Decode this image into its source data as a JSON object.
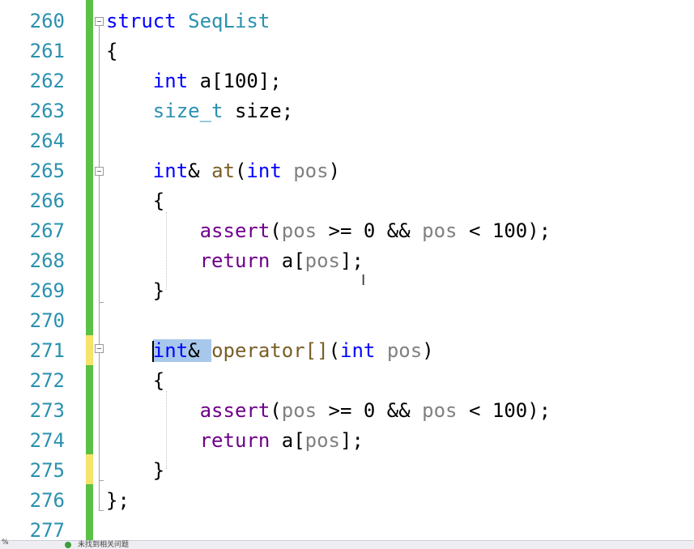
{
  "editor": {
    "line_numbers": [
      "260",
      "261",
      "262",
      "263",
      "264",
      "265",
      "266",
      "267",
      "268",
      "269",
      "270",
      "271",
      "272",
      "273",
      "274",
      "275",
      "276",
      "277"
    ],
    "lines": [
      [
        {
          "t": "struct ",
          "c": "kw"
        },
        {
          "t": "SeqList",
          "c": "ty"
        }
      ],
      [
        {
          "t": "{",
          "c": ""
        }
      ],
      [
        {
          "t": "    ",
          "c": ""
        },
        {
          "t": "int",
          "c": "kw"
        },
        {
          "t": " a[100];",
          "c": ""
        }
      ],
      [
        {
          "t": "    ",
          "c": ""
        },
        {
          "t": "size_t",
          "c": "ty"
        },
        {
          "t": " size;",
          "c": ""
        }
      ],
      [],
      [
        {
          "t": "    ",
          "c": ""
        },
        {
          "t": "int",
          "c": "kw"
        },
        {
          "t": "& ",
          "c": ""
        },
        {
          "t": "at",
          "c": "fn"
        },
        {
          "t": "(",
          "c": ""
        },
        {
          "t": "int",
          "c": "kw"
        },
        {
          "t": " ",
          "c": ""
        },
        {
          "t": "pos",
          "c": "par"
        },
        {
          "t": ")",
          "c": ""
        }
      ],
      [
        {
          "t": "    {",
          "c": ""
        }
      ],
      [
        {
          "t": "        ",
          "c": ""
        },
        {
          "t": "assert",
          "c": "mac"
        },
        {
          "t": "(",
          "c": ""
        },
        {
          "t": "pos",
          "c": "par"
        },
        {
          "t": " >= 0 && ",
          "c": ""
        },
        {
          "t": "pos",
          "c": "par"
        },
        {
          "t": " < 100);",
          "c": ""
        }
      ],
      [
        {
          "t": "        ",
          "c": ""
        },
        {
          "t": "return",
          "c": "mac"
        },
        {
          "t": " a[",
          "c": ""
        },
        {
          "t": "pos",
          "c": "par"
        },
        {
          "t": "];",
          "c": ""
        }
      ],
      [
        {
          "t": "    }",
          "c": ""
        }
      ],
      [],
      [
        {
          "t": "    ",
          "c": ""
        },
        {
          "t": "int",
          "c": "kw sel",
          "caret": true
        },
        {
          "t": "& ",
          "c": "sel"
        },
        {
          "t": "operator[]",
          "c": "fn"
        },
        {
          "t": "(",
          "c": ""
        },
        {
          "t": "int",
          "c": "kw"
        },
        {
          "t": " ",
          "c": ""
        },
        {
          "t": "pos",
          "c": "par"
        },
        {
          "t": ")",
          "c": ""
        }
      ],
      [
        {
          "t": "    {",
          "c": ""
        }
      ],
      [
        {
          "t": "        ",
          "c": ""
        },
        {
          "t": "assert",
          "c": "mac"
        },
        {
          "t": "(",
          "c": ""
        },
        {
          "t": "pos",
          "c": "par"
        },
        {
          "t": " >= 0 && ",
          "c": ""
        },
        {
          "t": "pos",
          "c": "par"
        },
        {
          "t": " < 100);",
          "c": ""
        }
      ],
      [
        {
          "t": "        ",
          "c": ""
        },
        {
          "t": "return",
          "c": "mac"
        },
        {
          "t": " a[",
          "c": ""
        },
        {
          "t": "pos",
          "c": "par"
        },
        {
          "t": "];",
          "c": ""
        }
      ],
      [
        {
          "t": "    }",
          "c": ""
        }
      ],
      [
        {
          "t": "};",
          "c": ""
        }
      ],
      []
    ],
    "yellow_change_lines": [
      "271",
      "275"
    ],
    "selection_text": "int& "
  },
  "status_bar": {
    "zoom": "%",
    "message": "未找到相关问题"
  },
  "colors": {
    "line_number": "#2b91af",
    "keyword": "#0000ff",
    "type": "#2b91af",
    "function": "#795e26",
    "macro": "#6f008a",
    "parameter": "#808080",
    "selection": "#a7c8ea",
    "changebar_saved": "#5bc046",
    "changebar_unsaved": "#f7e36b"
  }
}
